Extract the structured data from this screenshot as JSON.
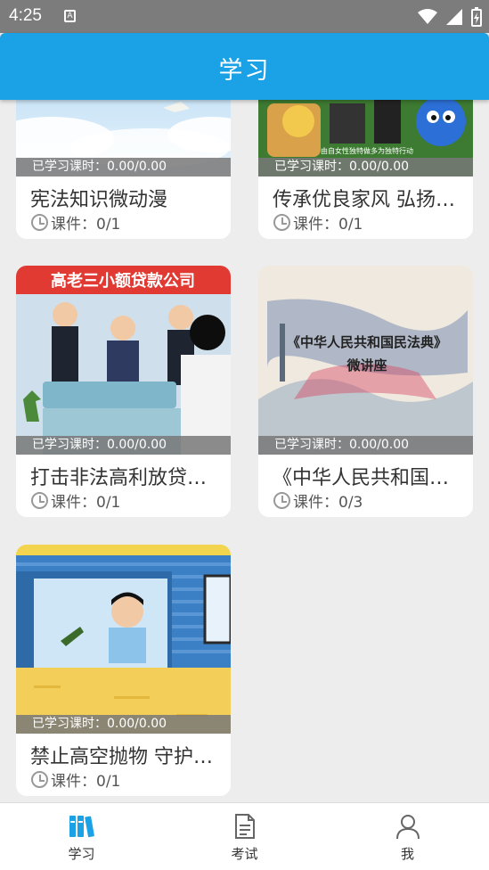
{
  "status_bar": {
    "time": "4:25",
    "notification_icon": "A"
  },
  "app_bar": {
    "title": "学习"
  },
  "courses": [
    {
      "progress_label": "已学习课时：0.00/0.00",
      "title": "宪法知识微动漫",
      "courseware": "课件：0/1"
    },
    {
      "progress_label": "已学习课时：0.00/0.00",
      "title": "传承优良家风 弘扬…",
      "courseware": "课件：0/1",
      "thumb_caption": "由自女性独特做多为独特行动"
    },
    {
      "progress_label": "已学习课时：0.00/0.00",
      "title": "打击非法高利放贷…",
      "courseware": "课件：0/1",
      "thumb_banner": "高老三小额贷款公司"
    },
    {
      "progress_label": "已学习课时：0.00/0.00",
      "title": "《中华人民共和国…",
      "courseware": "课件：0/3",
      "thumb_line1": "《中华人民共和国民法典》",
      "thumb_line2": "微讲座"
    },
    {
      "progress_label": "已学习课时：0.00/0.00",
      "title": "禁止高空抛物 守护…",
      "courseware": "课件：0/1"
    }
  ],
  "tab_bar": {
    "tabs": [
      {
        "label": "学习",
        "icon": "books-icon",
        "active": true
      },
      {
        "label": "考试",
        "icon": "document-icon",
        "active": false
      },
      {
        "label": "我",
        "icon": "person-icon",
        "active": false
      }
    ]
  },
  "colors": {
    "primary": "#1aa1e6",
    "background": "#ededed"
  }
}
